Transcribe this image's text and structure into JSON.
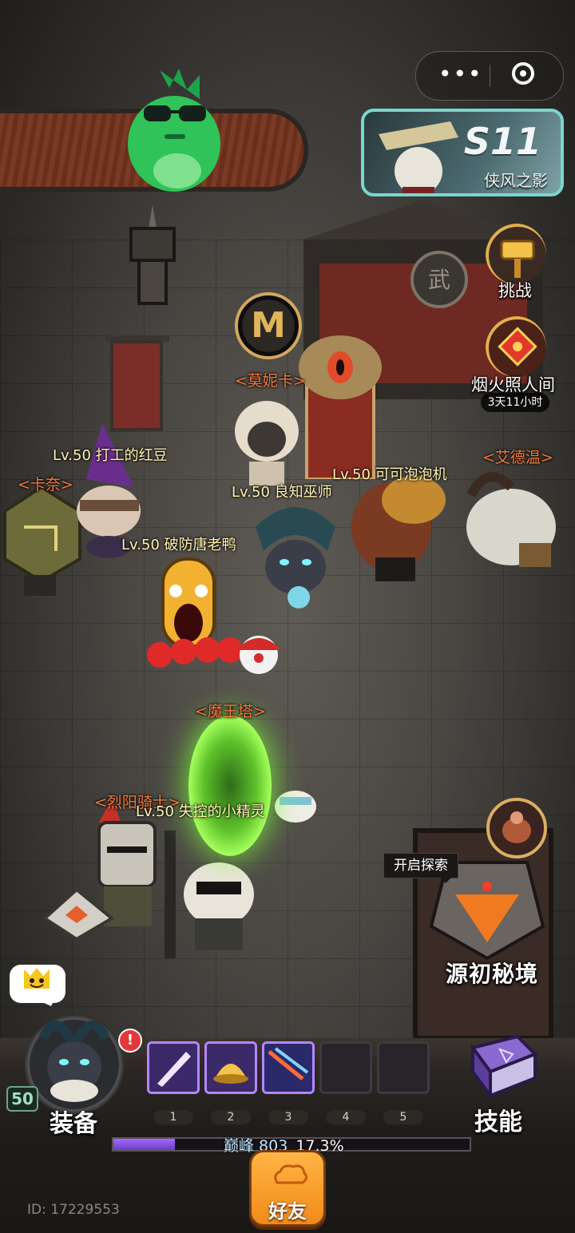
{
  "top_menu": {
    "more_icon": "more-dots-icon",
    "close_icon": "target-icon"
  },
  "season": {
    "title": "S11",
    "subtitle": "侠风之影"
  },
  "right_events": {
    "challenge_label": "挑战",
    "fireworks_label": "烟火照人间",
    "fireworks_timer": "3天11小时"
  },
  "scene": {
    "npcs": {
      "monica": "<莫妮卡>",
      "adwin": "<艾德温>",
      "kana": "<卡奈>",
      "demon_tower": "<魔王塔>",
      "sun_knight": "<烈阳骑士>"
    },
    "players": [
      {
        "label": "Lv.50 打工的红豆"
      },
      {
        "label": "Lv.50 良知巫师"
      },
      {
        "label": "Lv.50 可可泡泡机"
      },
      {
        "label": "Lv.50 破防唐老鸭"
      },
      {
        "label": "Lv.50 失控的小精灵"
      }
    ],
    "monogram": "M",
    "explore_tip": "开启探索",
    "origin_realm": "源初秘境"
  },
  "bottom": {
    "level": "50",
    "equip_label": "装备",
    "alert": "!",
    "skill_label": "技能",
    "slots": [
      {
        "num": "1",
        "filled": true
      },
      {
        "num": "2",
        "filled": true
      },
      {
        "num": "3",
        "filled": true
      },
      {
        "num": "4",
        "filled": false
      },
      {
        "num": "5",
        "filled": false
      }
    ],
    "rank_label": "巅峰 803",
    "rank_percent": "17.3%",
    "rank_progress": 0.173,
    "friends_label": "好友",
    "player_id": "ID: 17229553"
  },
  "colors": {
    "npc_label": "#f27a3d",
    "player_label": "#fff3b0",
    "accent_orange": "#f08a1a",
    "season_border": "#79d6cf"
  }
}
